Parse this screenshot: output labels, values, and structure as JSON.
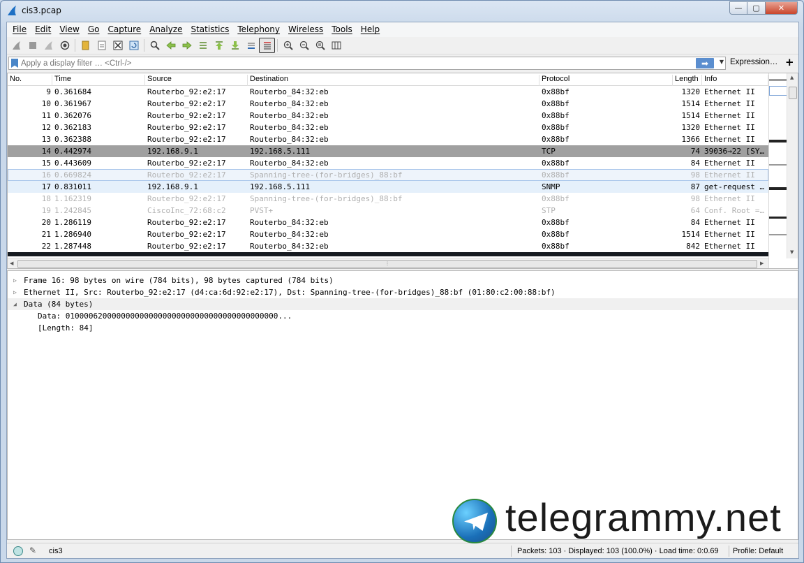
{
  "window": {
    "title": "cis3.pcap",
    "min": "—",
    "max": "▢",
    "close": "✕"
  },
  "menu": [
    "File",
    "Edit",
    "View",
    "Go",
    "Capture",
    "Analyze",
    "Statistics",
    "Telephony",
    "Wireless",
    "Tools",
    "Help"
  ],
  "filter": {
    "placeholder": "Apply a display filter … <Ctrl-/>",
    "expression": "Expression…",
    "plus": "+",
    "apply_arrow": "➡",
    "dropdown": "▼"
  },
  "columns": [
    "No.",
    "Time",
    "Source",
    "Destination",
    "Protocol",
    "Length",
    "Info"
  ],
  "packets": [
    {
      "no": "9",
      "time": "0.361684",
      "src": "Routerbo_92:e2:17",
      "dst": "Routerbo_84:32:eb",
      "proto": "0x88bf",
      "len": "1320",
      "info": "Ethernet II",
      "style": ""
    },
    {
      "no": "10",
      "time": "0.361967",
      "src": "Routerbo_92:e2:17",
      "dst": "Routerbo_84:32:eb",
      "proto": "0x88bf",
      "len": "1514",
      "info": "Ethernet II",
      "style": ""
    },
    {
      "no": "11",
      "time": "0.362076",
      "src": "Routerbo_92:e2:17",
      "dst": "Routerbo_84:32:eb",
      "proto": "0x88bf",
      "len": "1514",
      "info": "Ethernet II",
      "style": ""
    },
    {
      "no": "12",
      "time": "0.362183",
      "src": "Routerbo_92:e2:17",
      "dst": "Routerbo_84:32:eb",
      "proto": "0x88bf",
      "len": "1320",
      "info": "Ethernet II",
      "style": ""
    },
    {
      "no": "13",
      "time": "0.362388",
      "src": "Routerbo_92:e2:17",
      "dst": "Routerbo_84:32:eb",
      "proto": "0x88bf",
      "len": "1366",
      "info": "Ethernet II",
      "style": ""
    },
    {
      "no": "14",
      "time": "0.442974",
      "src": "192.168.9.1",
      "dst": "192.168.5.111",
      "proto": "TCP",
      "len": "74",
      "info": "39036→22 [SY…",
      "style": "gray"
    },
    {
      "no": "15",
      "time": "0.443609",
      "src": "Routerbo_92:e2:17",
      "dst": "Routerbo_84:32:eb",
      "proto": "0x88bf",
      "len": "84",
      "info": "Ethernet II",
      "style": ""
    },
    {
      "no": "16",
      "time": "0.669824",
      "src": "Routerbo_92:e2:17",
      "dst": "Spanning-tree-(for-bridges)_88:bf",
      "proto": "0x88bf",
      "len": "98",
      "info": "Ethernet II",
      "style": "dim-sel"
    },
    {
      "no": "17",
      "time": "0.831011",
      "src": "192.168.9.1",
      "dst": "192.168.5.111",
      "proto": "SNMP",
      "len": "87",
      "info": "get-request …",
      "style": "hl"
    },
    {
      "no": "18",
      "time": "1.162319",
      "src": "Routerbo_92:e2:17",
      "dst": "Spanning-tree-(for-bridges)_88:bf",
      "proto": "0x88bf",
      "len": "98",
      "info": "Ethernet II",
      "style": "dim"
    },
    {
      "no": "19",
      "time": "1.242845",
      "src": "CiscoInc_72:68:c2",
      "dst": "PVST+",
      "proto": "STP",
      "len": "64",
      "info": "Conf. Root =…",
      "style": "dim"
    },
    {
      "no": "20",
      "time": "1.286119",
      "src": "Routerbo_92:e2:17",
      "dst": "Routerbo_84:32:eb",
      "proto": "0x88bf",
      "len": "84",
      "info": "Ethernet II",
      "style": ""
    },
    {
      "no": "21",
      "time": "1.286940",
      "src": "Routerbo_92:e2:17",
      "dst": "Routerbo_84:32:eb",
      "proto": "0x88bf",
      "len": "1514",
      "info": "Ethernet II",
      "style": ""
    },
    {
      "no": "22",
      "time": "1.287448",
      "src": "Routerbo_92:e2:17",
      "dst": "Routerbo_84:32:eb",
      "proto": "0x88bf",
      "len": "842",
      "info": "Ethernet II",
      "style": ""
    }
  ],
  "details": [
    {
      "tri": "▷",
      "text": "Frame 16: 98 bytes on wire (784 bits), 98 bytes captured (784 bits)"
    },
    {
      "tri": "▷",
      "text": "Ethernet II, Src: Routerbo_92:e2:17 (d4:ca:6d:92:e2:17), Dst: Spanning-tree-(for-bridges)_88:bf (01:80:c2:00:88:bf)"
    },
    {
      "tri": "◢",
      "text": "Data (84 bytes)"
    },
    {
      "tri": "",
      "text": "Data: 0100006200000000000000000000000000000000000000..."
    },
    {
      "tri": "",
      "text": "[Length: 84]"
    }
  ],
  "status": {
    "file": "cis3",
    "packets": "Packets: 103 · Displayed: 103 (100.0%) · Load time: 0:0.69",
    "profile": "Profile: Default"
  },
  "watermark": "telegrammy.net",
  "colors": {
    "selected_gray": "#a0a0a0",
    "highlight_blue": "#e5f0fb",
    "apply_blue": "#5b8ecf"
  }
}
